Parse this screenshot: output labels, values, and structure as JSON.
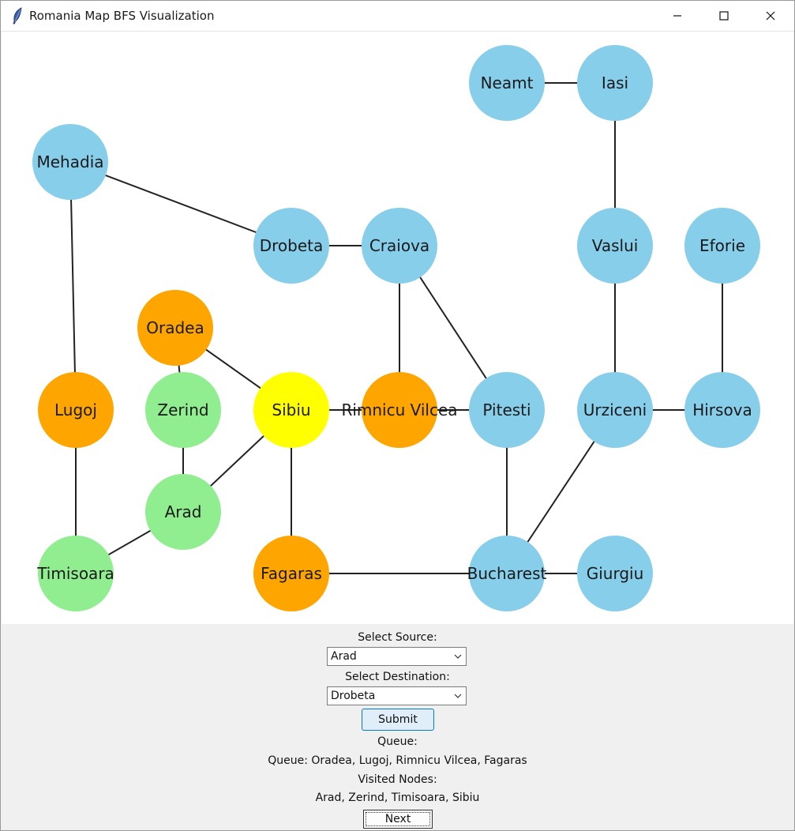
{
  "window": {
    "title": "Romania Map BFS Visualization",
    "icon": "feather-icon",
    "controls": [
      "minimize-icon",
      "maximize-icon",
      "close-icon"
    ]
  },
  "colors": {
    "unvisited": "#87ceeb",
    "visited": "#90ee90",
    "queued": "#ffa500",
    "current": "#ffff00",
    "edge": "#222222"
  },
  "graph": {
    "nodes": {
      "Arad": "visited",
      "Zerind": "visited",
      "Timisoara": "visited",
      "Sibiu": "current",
      "Oradea": "queued",
      "Lugoj": "queued",
      "Rimnicu Vilcea": "queued",
      "Fagaras": "queued",
      "Mehadia": "unvisited",
      "Drobeta": "unvisited",
      "Craiova": "unvisited",
      "Pitesti": "unvisited",
      "Bucharest": "unvisited",
      "Giurgiu": "unvisited",
      "Urziceni": "unvisited",
      "Hirsova": "unvisited",
      "Eforie": "unvisited",
      "Vaslui": "unvisited",
      "Iasi": "unvisited",
      "Neamt": "unvisited"
    },
    "edges": [
      [
        "Neamt",
        "Iasi"
      ],
      [
        "Iasi",
        "Vaslui"
      ],
      [
        "Vaslui",
        "Urziceni"
      ],
      [
        "Eforie",
        "Hirsova"
      ],
      [
        "Urziceni",
        "Hirsova"
      ],
      [
        "Urziceni",
        "Bucharest"
      ],
      [
        "Bucharest",
        "Giurgiu"
      ],
      [
        "Bucharest",
        "Pitesti"
      ],
      [
        "Fagaras",
        "Bucharest"
      ],
      [
        "Pitesti",
        "Rimnicu Vilcea"
      ],
      [
        "Pitesti",
        "Craiova"
      ],
      [
        "Craiova",
        "Rimnicu Vilcea"
      ],
      [
        "Drobeta",
        "Craiova"
      ],
      [
        "Mehadia",
        "Drobeta"
      ],
      [
        "Mehadia",
        "Lugoj"
      ],
      [
        "Lugoj",
        "Timisoara"
      ],
      [
        "Timisoara",
        "Arad"
      ],
      [
        "Arad",
        "Zerind"
      ],
      [
        "Zerind",
        "Oradea"
      ],
      [
        "Oradea",
        "Sibiu"
      ],
      [
        "Arad",
        "Sibiu"
      ],
      [
        "Sibiu",
        "Rimnicu Vilcea"
      ],
      [
        "Sibiu",
        "Fagaras"
      ]
    ]
  },
  "controls": {
    "source_label": "Select Source:",
    "source_value": "Arad",
    "destination_label": "Select Destination:",
    "destination_value": "Drobeta",
    "submit_label": "Submit",
    "queue_heading": "Queue:",
    "queue_text": "Queue: Oradea, Lugoj, Rimnicu Vilcea, Fagaras",
    "visited_heading": "Visited Nodes:",
    "visited_text": "Arad, Zerind, Timisoara, Sibiu",
    "next_label": "Next"
  }
}
